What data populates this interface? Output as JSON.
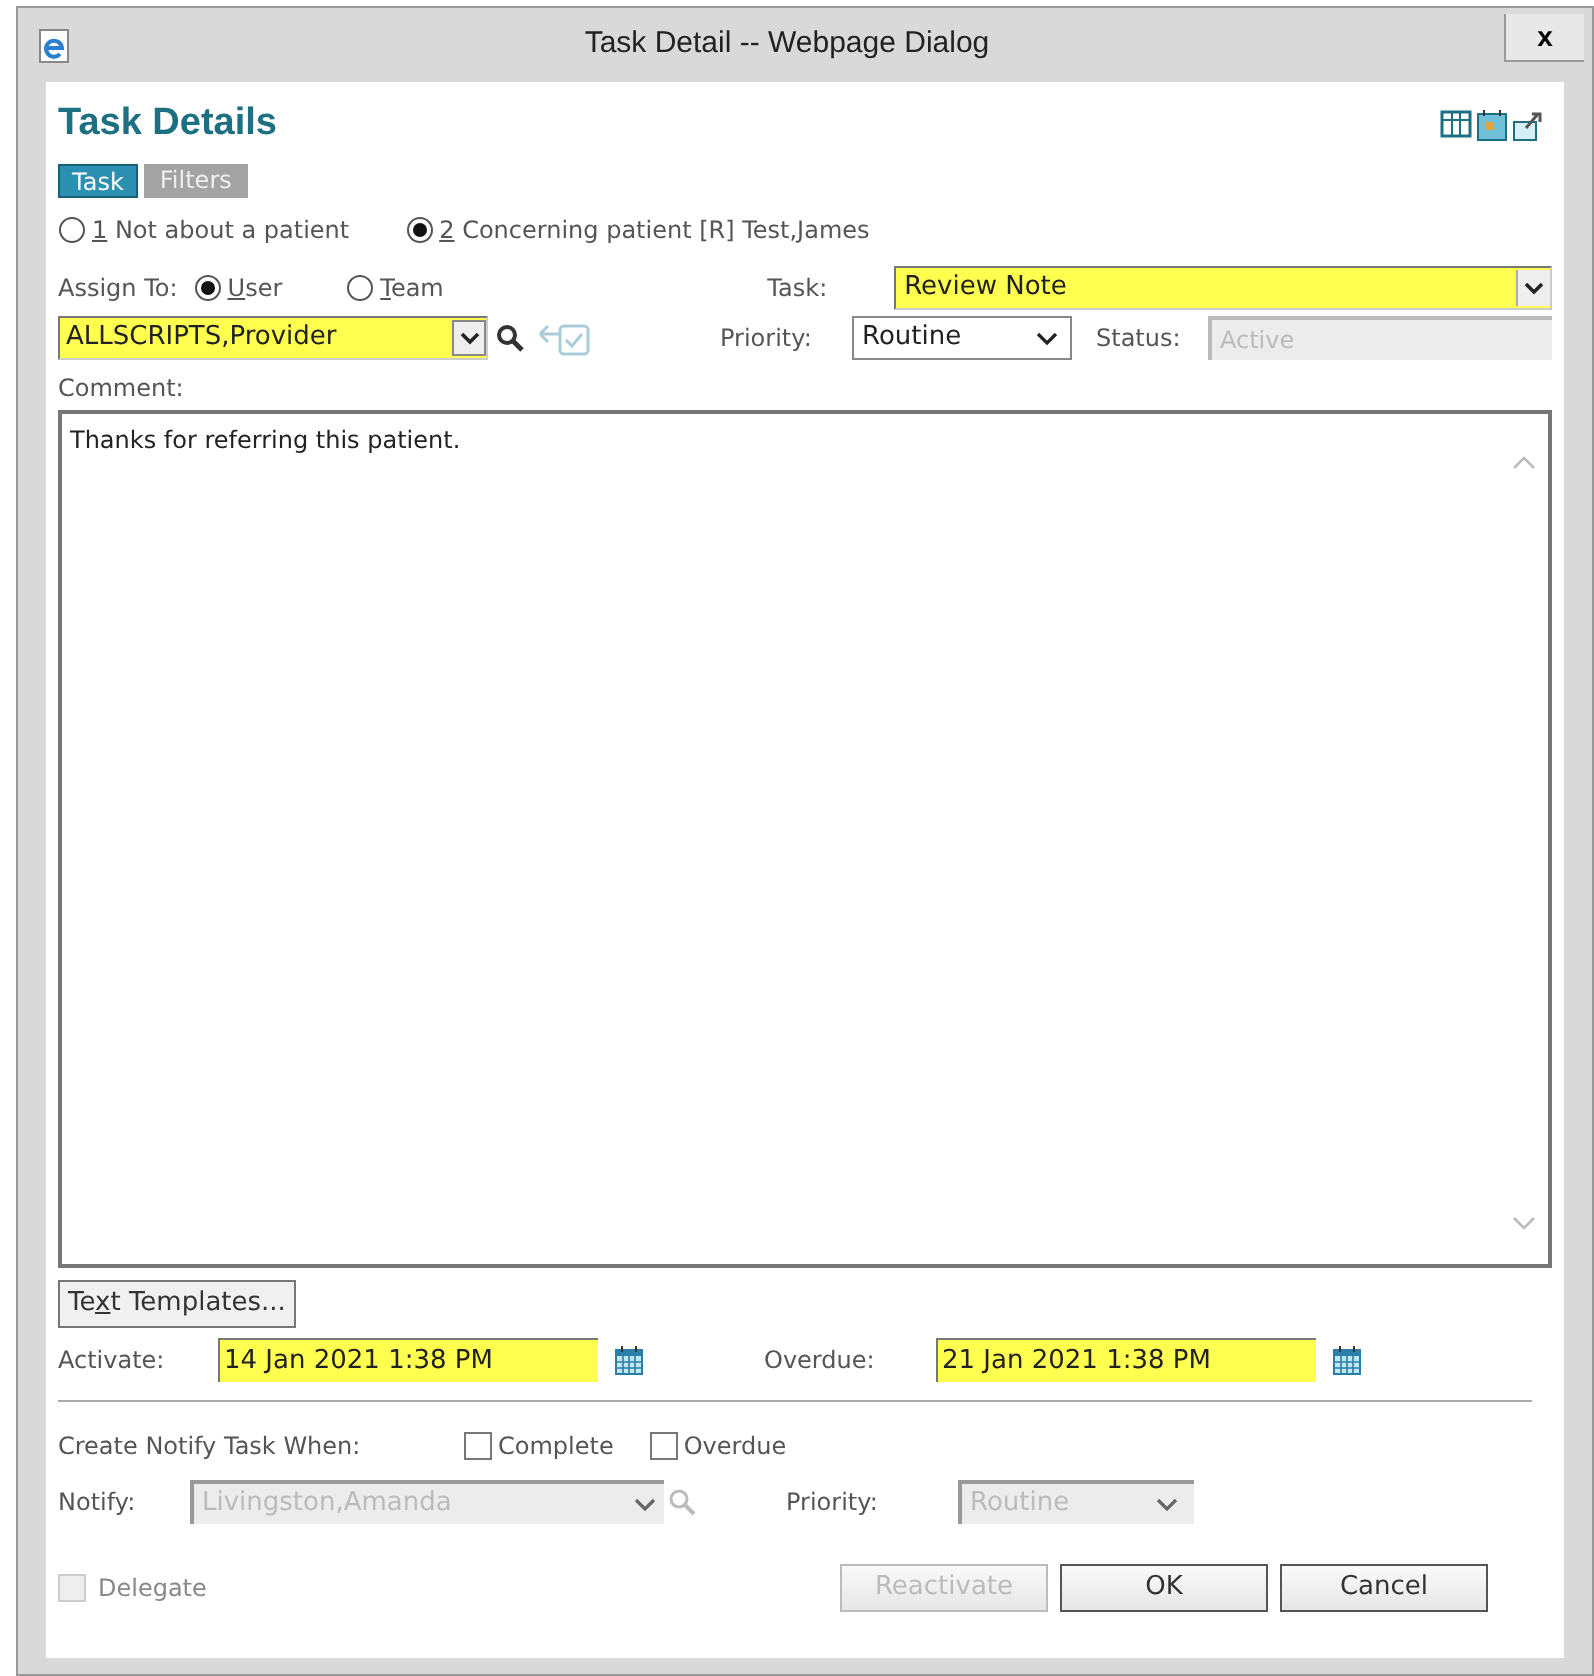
{
  "window": {
    "title": "Task Detail -- Webpage Dialog",
    "close": "x"
  },
  "heading": "Task Details",
  "tabs": [
    {
      "label": "Task",
      "selected": true
    },
    {
      "label": "Filters",
      "selected": false
    }
  ],
  "patient_options": [
    {
      "access_key": "1",
      "label": " Not about a patient",
      "selected": false
    },
    {
      "access_key": "2",
      "label": " Concerning patient [R] Test,James",
      "selected": true
    }
  ],
  "assign_to": {
    "label": "Assign To:",
    "options": [
      {
        "access_key": "U",
        "label": "ser",
        "selected": true
      },
      {
        "access_key": "T",
        "label": "eam",
        "selected": false
      }
    ]
  },
  "assignee": {
    "value": "ALLSCRIPTS,Provider"
  },
  "task": {
    "label": "Task:",
    "value": "Review Note"
  },
  "priority": {
    "label": "Priority:",
    "value": "Routine"
  },
  "status": {
    "label": "Status:",
    "value": "Active",
    "disabled": true
  },
  "comment": {
    "label": "Comment:",
    "value": "Thanks for referring this patient."
  },
  "text_templates": {
    "before": "Te",
    "access_key": "x",
    "after": "t Templates..."
  },
  "activate": {
    "label": "Activate:",
    "value": "14 Jan 2021 1:38 PM"
  },
  "overdue": {
    "label": "Overdue:",
    "value": "21 Jan 2021 1:38 PM"
  },
  "notify_when": {
    "label": "Create Notify Task When:",
    "options": [
      {
        "label": "Complete",
        "checked": false
      },
      {
        "label": "Overdue",
        "checked": false
      }
    ]
  },
  "notify": {
    "label": "Notify:",
    "value": "Livingston,Amanda",
    "disabled": true
  },
  "notify_priority": {
    "label": "Priority:",
    "value": "Routine",
    "disabled": true
  },
  "delegate": {
    "label": "Delegate",
    "checked": false,
    "disabled": true
  },
  "buttons": [
    {
      "label": "Reactivate",
      "disabled": true
    },
    {
      "label": "OK",
      "disabled": false
    },
    {
      "label": "Cancel",
      "disabled": false
    }
  ]
}
